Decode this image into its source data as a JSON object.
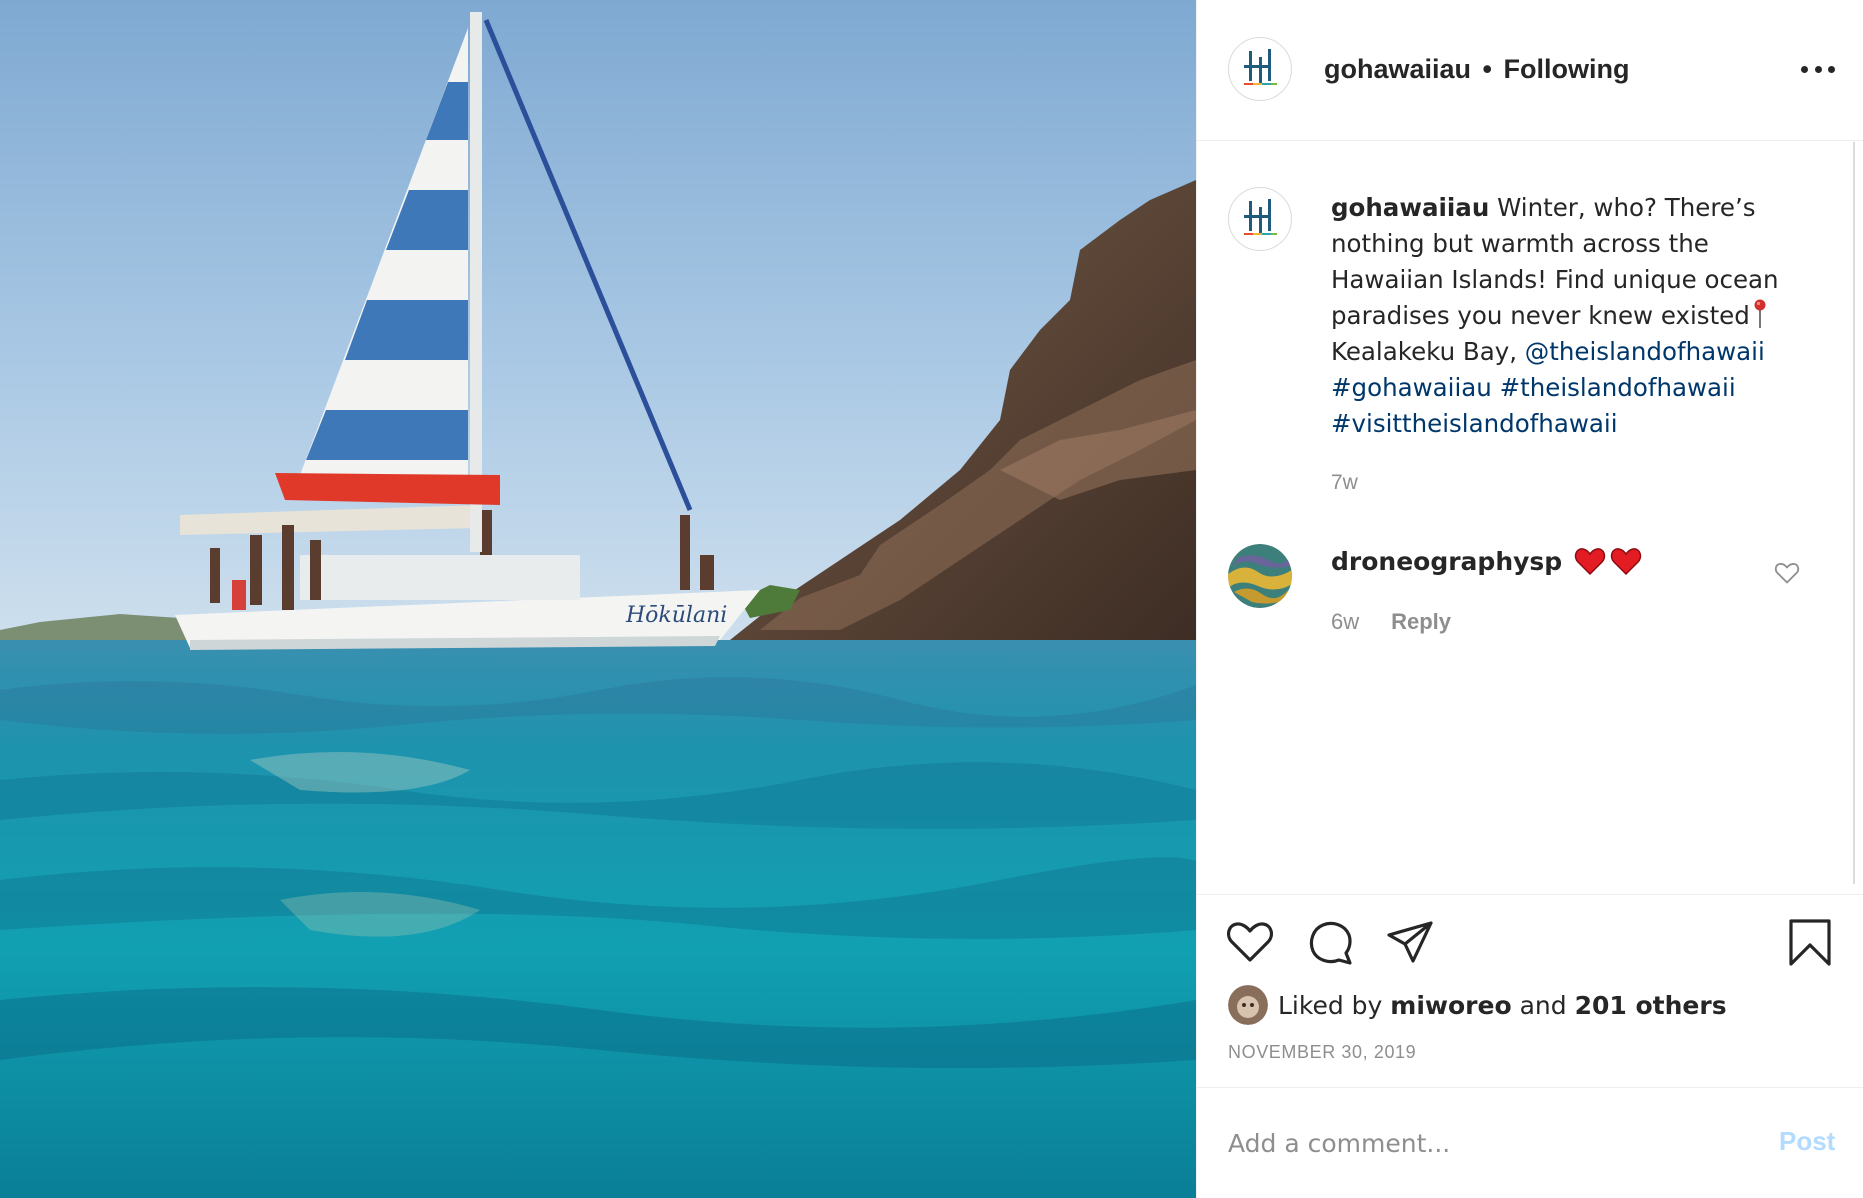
{
  "header": {
    "username": "gohawaiiau",
    "separator": "•",
    "follow_status": "Following",
    "more_icon": "more-horizontal-icon"
  },
  "caption": {
    "username": "gohawaiiau",
    "text_main": "Winter, who? There’s nothing but warmth across the Hawaiian Islands! Find unique ocean paradises you never knew existed",
    "pin_icon": "round-pushpin-emoji",
    "location": "Kealakeku Bay,",
    "mention": "@theislandofhawaii",
    "hashtags": [
      "#gohawaiiau",
      "#theislandofhawaii",
      "#visittheislandofhawaii"
    ],
    "time": "7w"
  },
  "comment": {
    "username": "droneographysp",
    "emojis": [
      "red-heart-emoji",
      "red-heart-emoji"
    ],
    "time": "6w",
    "reply_label": "Reply",
    "like_icon": "heart-outline-icon"
  },
  "actions": {
    "icons": [
      "heart-icon",
      "comment-icon",
      "share-icon",
      "bookmark-icon"
    ]
  },
  "likes": {
    "prefix": "Liked by",
    "user": "miworeo",
    "conjunction": "and",
    "others": "201 others"
  },
  "date": "NOVEMBER 30, 2019",
  "add_comment": {
    "placeholder": "Add a comment...",
    "post_label": "Post"
  },
  "boat_name": "Hōkūlani",
  "colors": {
    "link": "#00376b",
    "muted": "#8e8e8e",
    "post_disabled": "#b3dbff",
    "sail_blue": "#3f78b8",
    "sail_red": "#e0392a",
    "water": "#1fa3b6"
  }
}
